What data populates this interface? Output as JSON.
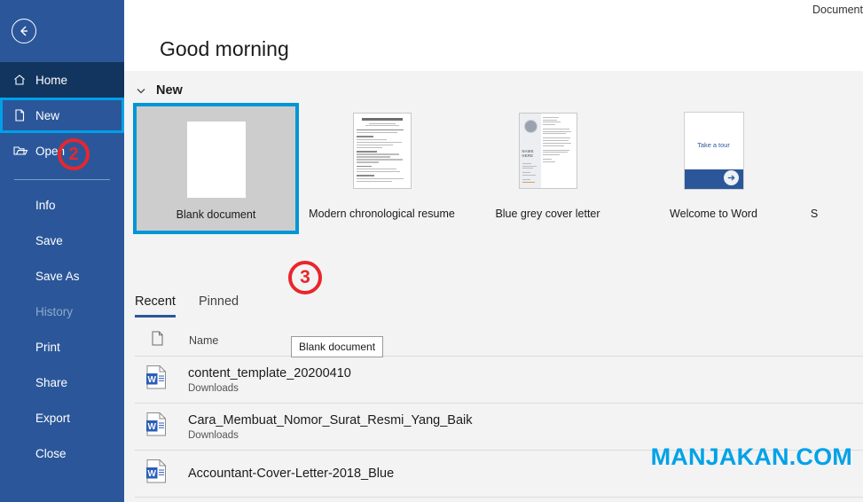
{
  "window": {
    "document_label": "Document"
  },
  "sidebar": {
    "back_icon": "back-arrow-icon",
    "nav": [
      {
        "label": "Home",
        "icon": "home-icon",
        "state": "hovered"
      },
      {
        "label": "New",
        "icon": "new-document-icon",
        "state": "selected"
      },
      {
        "label": "Open",
        "icon": "open-folder-icon",
        "state": "normal"
      }
    ],
    "commands": [
      {
        "label": "Info",
        "disabled": false
      },
      {
        "label": "Save",
        "disabled": false
      },
      {
        "label": "Save As",
        "disabled": false
      },
      {
        "label": "History",
        "disabled": true
      },
      {
        "label": "Print",
        "disabled": false
      },
      {
        "label": "Share",
        "disabled": false
      },
      {
        "label": "Export",
        "disabled": false
      },
      {
        "label": "Close",
        "disabled": false
      }
    ]
  },
  "main": {
    "greeting": "Good morning",
    "new_section": {
      "title": "New",
      "collapse_icon": "chevron-down-icon",
      "templates": [
        {
          "label": "Blank document",
          "type": "blank",
          "selected": true
        },
        {
          "label": "Modern chronological resume",
          "type": "resume",
          "selected": false
        },
        {
          "label": "Blue grey cover letter",
          "type": "cover-letter",
          "selected": false
        },
        {
          "label": "Welcome to Word",
          "type": "tour",
          "selected": false,
          "thumb_text": "Take a tour"
        },
        {
          "label": "S",
          "type": "cut-off",
          "selected": false
        }
      ]
    },
    "tooltip": "Blank document",
    "tabs": [
      {
        "label": "Recent",
        "active": true
      },
      {
        "label": "Pinned",
        "active": false
      }
    ],
    "list_header": {
      "doc_icon": "document-icon",
      "name_column": "Name"
    },
    "files": [
      {
        "name": "content_template_20200410",
        "location": "Downloads",
        "icon": "word-document-icon"
      },
      {
        "name": "Cara_Membuat_Nomor_Surat_Resmi_Yang_Baik",
        "location": "Downloads",
        "icon": "word-document-icon"
      },
      {
        "name": "Accountant-Cover-Letter-2018_Blue",
        "location": "",
        "icon": "word-document-icon"
      }
    ]
  },
  "annotations": {
    "markers": [
      {
        "id": "2",
        "label": "2",
        "target": "sidebar-open-area"
      },
      {
        "id": "3",
        "label": "3",
        "target": "blank-document-tooltip-area"
      }
    ],
    "watermark": "MANJAKAN.COM"
  },
  "colors": {
    "sidebar_blue": "#2b579a",
    "home_dark_blue": "#12355f",
    "accent_cyan": "#0096d6",
    "marker_red": "#e8262c",
    "watermark_blue": "#00a2e8",
    "content_bg": "#f3f3f3"
  }
}
